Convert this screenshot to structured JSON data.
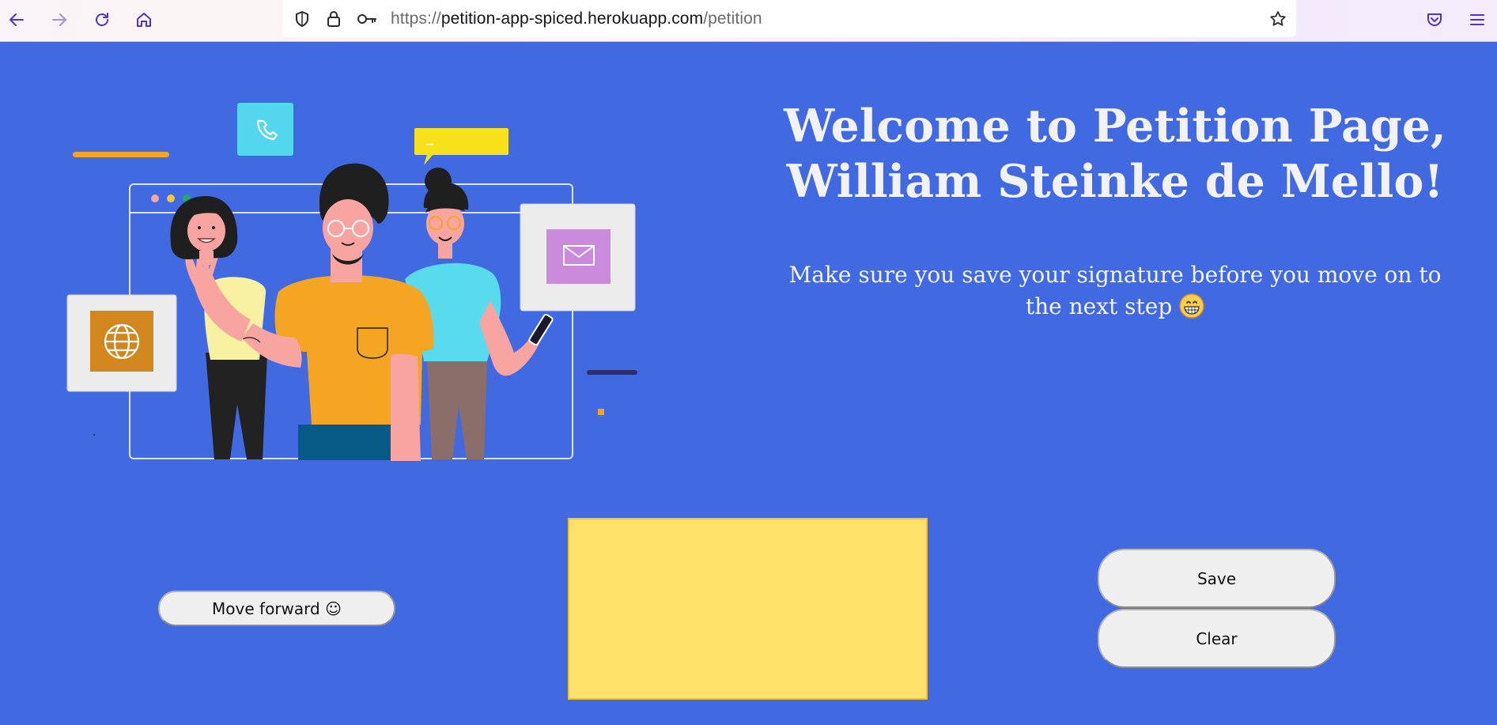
{
  "browser": {
    "url_scheme": "https://",
    "url_host": "petition-app-spiced.herokuapp.com",
    "url_path": "/petition",
    "icons": [
      "back-icon",
      "forward-icon",
      "reload-icon",
      "home-icon",
      "shield-icon",
      "lock-icon",
      "key-icon",
      "bookmark-star-icon",
      "pocket-icon",
      "menu-icon"
    ]
  },
  "page": {
    "title_line1": "Welcome to Petition Page,",
    "title_line2": "William Steinke de Mello!",
    "subtitle": "Make sure you save your signature before you move on to the next step",
    "subtitle_emoji": "grinning-face-icon",
    "move_forward_label": "Move forward ☺",
    "save_label": "Save",
    "clear_label": "Clear",
    "canvas_color": "#ffe06b",
    "background_color": "#4169e1"
  }
}
